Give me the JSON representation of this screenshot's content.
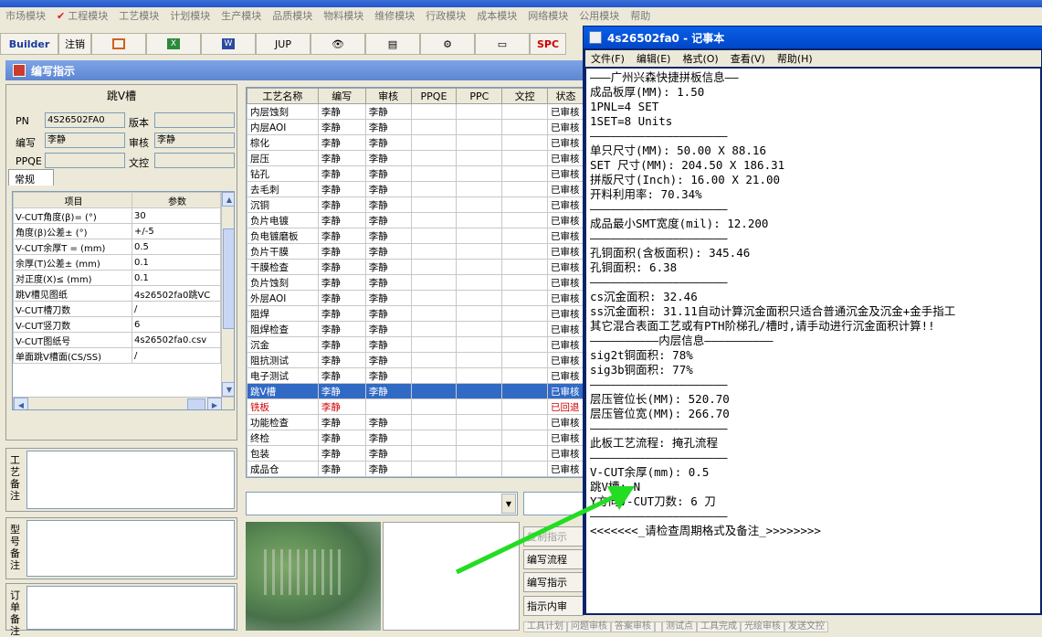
{
  "menubar": {
    "items": [
      "市场模块",
      "工程模块",
      "工艺模块",
      "计划模块",
      "生产模块",
      "品质模块",
      "物料模块",
      "维修模块",
      "行政模块",
      "成本模块",
      "网络模块",
      "公用模块",
      "帮助"
    ]
  },
  "toolbar": {
    "builder": "Builder",
    "cancel": "注销",
    "jup": "JUP",
    "spc": "SPC"
  },
  "panel": {
    "title": "编写指示"
  },
  "form": {
    "process_name": "跳V槽",
    "pn_label": "PN",
    "pn_value": "4S26502FA0",
    "version_label": "版本",
    "version_value": "",
    "writer_label": "编写",
    "writer_value": "李静",
    "reviewer_label": "审核",
    "reviewer_value": "李静",
    "ppqe_label": "PPQE",
    "ppqe_value": "",
    "doc_label": "文控",
    "doc_value": "",
    "tab": "常规"
  },
  "params": {
    "headers": [
      "项目",
      "参数"
    ],
    "rows": [
      [
        "V-CUT角度(β)= (°)",
        "30"
      ],
      [
        "角度(β)公差± (°)",
        "+/-5"
      ],
      [
        "V-CUT余厚T = (mm)",
        "0.5"
      ],
      [
        "余厚(T)公差± (mm)",
        "0.1"
      ],
      [
        "对正度(X)≤ (mm)",
        "0.1"
      ],
      [
        "跳V槽见图纸",
        "4s26502fa0跳VC"
      ],
      [
        "V-CUT槽刀数",
        "/"
      ],
      [
        "V-CUT竖刀数",
        "6"
      ],
      [
        "V-CUT图纸号",
        "4s26502fa0.csv"
      ],
      [
        "单面跳V槽面(CS/SS)",
        "/"
      ]
    ]
  },
  "remarks": {
    "craft": "工艺备注",
    "model": "型号备注",
    "order": "订单备注"
  },
  "process": {
    "headers": [
      "工艺名称",
      "编写",
      "审核",
      "PPQE",
      "PPC",
      "文控",
      "状态"
    ],
    "rows": [
      [
        "内层蚀刻",
        "李静",
        "李静",
        "",
        "",
        "",
        "已审核"
      ],
      [
        "内层AOI",
        "李静",
        "李静",
        "",
        "",
        "",
        "已审核"
      ],
      [
        "棕化",
        "李静",
        "李静",
        "",
        "",
        "",
        "已审核"
      ],
      [
        "层压",
        "李静",
        "李静",
        "",
        "",
        "",
        "已审核"
      ],
      [
        "钻孔",
        "李静",
        "李静",
        "",
        "",
        "",
        "已审核"
      ],
      [
        "去毛刺",
        "李静",
        "李静",
        "",
        "",
        "",
        "已审核"
      ],
      [
        "沉铜",
        "李静",
        "李静",
        "",
        "",
        "",
        "已审核"
      ],
      [
        "负片电镀",
        "李静",
        "李静",
        "",
        "",
        "",
        "已审核"
      ],
      [
        "负电镀磨板",
        "李静",
        "李静",
        "",
        "",
        "",
        "已审核"
      ],
      [
        "负片干膜",
        "李静",
        "李静",
        "",
        "",
        "",
        "已审核"
      ],
      [
        "干膜检查",
        "李静",
        "李静",
        "",
        "",
        "",
        "已审核"
      ],
      [
        "负片蚀刻",
        "李静",
        "李静",
        "",
        "",
        "",
        "已审核"
      ],
      [
        "外层AOI",
        "李静",
        "李静",
        "",
        "",
        "",
        "已审核"
      ],
      [
        "阻焊",
        "李静",
        "李静",
        "",
        "",
        "",
        "已审核"
      ],
      [
        "阻焊检查",
        "李静",
        "李静",
        "",
        "",
        "",
        "已审核"
      ],
      [
        "沉金",
        "李静",
        "李静",
        "",
        "",
        "",
        "已审核"
      ],
      [
        "阻抗测试",
        "李静",
        "李静",
        "",
        "",
        "",
        "已审核"
      ],
      [
        "电子测试",
        "李静",
        "李静",
        "",
        "",
        "",
        "已审核"
      ],
      [
        "跳V槽",
        "李静",
        "李静",
        "",
        "",
        "",
        "已审核"
      ],
      [
        "铣板",
        "李静",
        "",
        "",
        "",
        "",
        "已回退"
      ],
      [
        "功能检查",
        "李静",
        "李静",
        "",
        "",
        "",
        "已审核"
      ],
      [
        "终检",
        "李静",
        "李静",
        "",
        "",
        "",
        "已审核"
      ],
      [
        "包装",
        "李静",
        "李静",
        "",
        "",
        "",
        "已审核"
      ],
      [
        "成品仓",
        "李静",
        "李静",
        "",
        "",
        "",
        "已审核"
      ]
    ],
    "selected": 18,
    "error": 19
  },
  "side_buttons": [
    {
      "label": "复制指示",
      "dim": true
    },
    {
      "label": "编写流程",
      "dim": false
    },
    {
      "label": "编写指示",
      "dim": false
    },
    {
      "label": "指示内审",
      "dim": false
    }
  ],
  "bottom_buttons": [
    "工具计划",
    "问题审核",
    "答案审核",
    "",
    "测试点",
    "工具完成",
    "光绘审核",
    "发送文控"
  ],
  "notepad": {
    "title": "4s26502fa0 - 记事本",
    "menu": [
      "文件(F)",
      "编辑(E)",
      "格式(O)",
      "查看(V)",
      "帮助(H)"
    ],
    "lines": [
      "———广州兴森快捷拼板信息——",
      "成品板厚(MM): 1.50",
      "1PNL=4 SET",
      "1SET=8 Units",
      "————————————————————",
      "单只尺寸(MM): 50.00 X 88.16",
      "SET 尺寸(MM): 204.50 X 186.31",
      "拼版尺寸(Inch): 16.00 X 21.00",
      "开料利用率: 70.34%",
      "————————————————————",
      "成品最小SMT宽度(mil): 12.200",
      "————————————————————",
      "孔铜面积(含板面积): 345.46",
      "孔铜面积: 6.38",
      "————————————————————",
      "cs沉金面积: 32.46",
      "ss沉金面积: 31.11自动计算沉金面积只适合普通沉金及沉金+金手指工",
      "其它混合表面工艺或有PTH阶梯孔/槽时,请手动进行沉金面积计算!!",
      "——————————内层信息——————————",
      "sig2t铜面积: 78%",
      "sig3b铜面积: 77%",
      "————————————————————",
      "层压管位长(MM): 520.70",
      "层压管位宽(MM): 266.70",
      "————————————————————",
      "此板工艺流程: 掩孔流程",
      "————————————————————",
      "V-CUT余厚(mm): 0.5",
      "跳V槽: N",
      "Y方向V-CUT刀数: 6 刀",
      "————————————————————",
      "<<<<<<<_请检查周期格式及备注_>>>>>>>>"
    ]
  },
  "colors": {
    "selection": "#316ac5",
    "arrow": "#22dd22",
    "titlebar": "#0047c8"
  }
}
